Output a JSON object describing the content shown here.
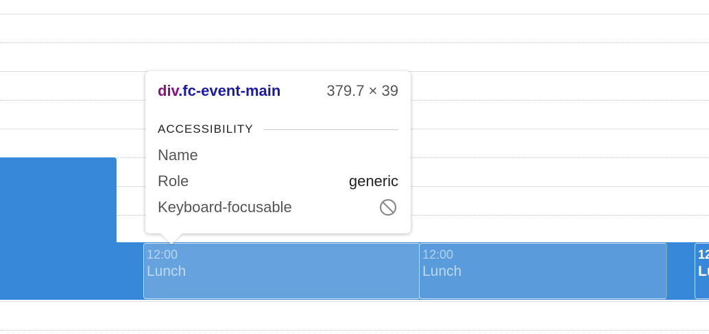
{
  "calendar": {
    "events": [
      {
        "time": "12:00",
        "title": "Lunch"
      },
      {
        "time": "12:00",
        "title": "Lunch"
      },
      {
        "time": "12",
        "title": "Lu"
      }
    ]
  },
  "tooltip": {
    "selector_tag": "div",
    "selector_class": ".fc-event-main",
    "size": "379.7 × 39",
    "section_label": "ACCESSIBILITY",
    "rows": [
      {
        "key": "Name",
        "value": ""
      },
      {
        "key": "Role",
        "value": "generic"
      },
      {
        "key": "Keyboard-focusable",
        "value_icon": "blocked-icon"
      }
    ]
  },
  "colors": {
    "event_bg": "#3788d8",
    "event_highlight": "#5a9bdb",
    "tag_color": "#881280",
    "class_color": "#1a1aa6"
  }
}
